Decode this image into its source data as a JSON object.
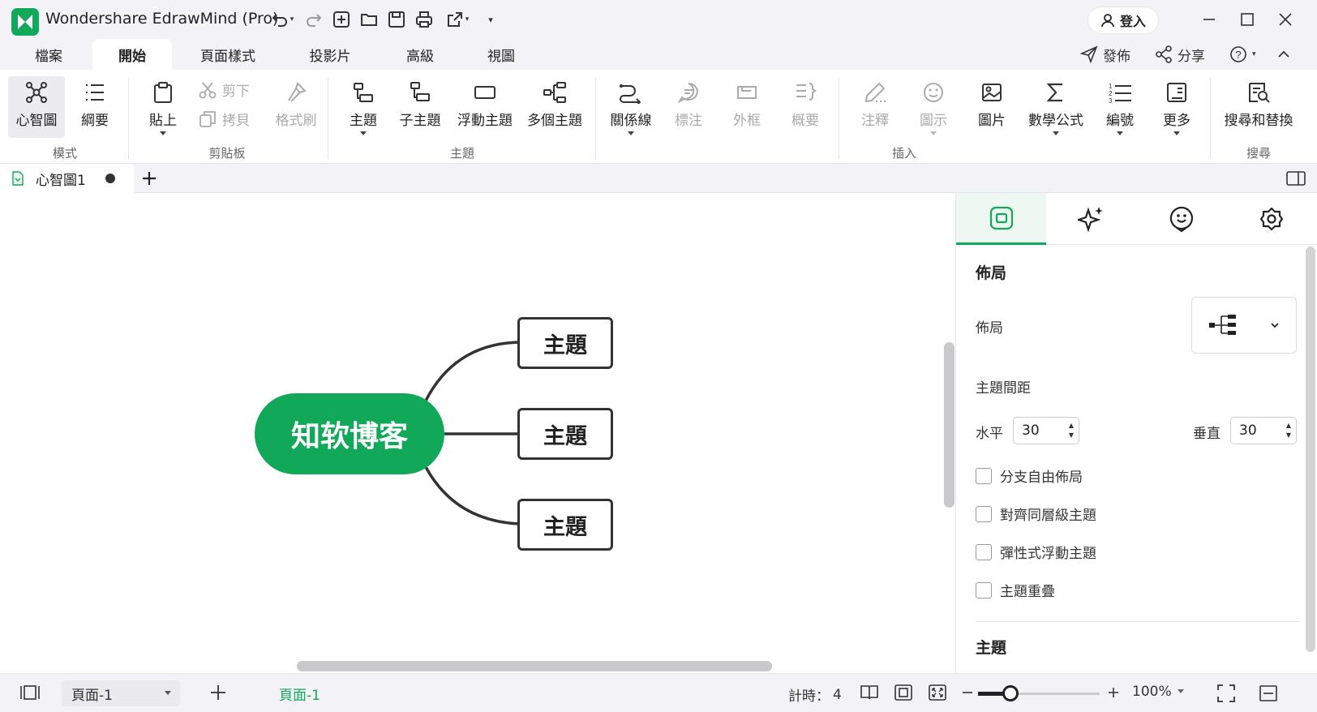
{
  "app": {
    "title": "Wondershare EdrawMind (Pro)",
    "login_label": "登入"
  },
  "menu": {
    "tabs": [
      "檔案",
      "開始",
      "頁面樣式",
      "投影片",
      "高級",
      "視圖"
    ],
    "active": "開始",
    "publish": "發佈",
    "share": "分享"
  },
  "ribbon": {
    "mode": {
      "mindmap": "心智圖",
      "outline": "綱要",
      "group": "模式"
    },
    "clipboard": {
      "paste": "貼上",
      "cut": "剪下",
      "copy": "拷貝",
      "format_painter": "格式刷",
      "group": "剪貼板"
    },
    "topic": {
      "topic": "主題",
      "subtopic": "子主題",
      "floating": "浮動主題",
      "multiple": "多個主題",
      "group": "主題"
    },
    "insert": {
      "relation": "關係線",
      "callout": "標注",
      "boundary": "外框",
      "summary": "概要",
      "comment": "注釋",
      "icon": "圖示",
      "picture": "圖片",
      "formula": "數學公式",
      "numbering": "編號",
      "more": "更多",
      "group": "插入"
    },
    "search": {
      "find_replace": "搜尋和替換",
      "group": "搜尋"
    }
  },
  "doc_tab": {
    "name": "心智圖1"
  },
  "mindmap": {
    "central": "知软博客",
    "topics": [
      "主題",
      "主題",
      "主題"
    ]
  },
  "panel": {
    "section_layout": "佈局",
    "layout_label": "佈局",
    "spacing_label": "主題間距",
    "horizontal_label": "水平",
    "horizontal_value": "30",
    "vertical_label": "垂直",
    "vertical_value": "30",
    "checkboxes": [
      "分支自由佈局",
      "對齊同層級主題",
      "彈性式浮動主題",
      "主題重疊"
    ],
    "section_topic": "主題"
  },
  "status": {
    "page_select": "頁面-1",
    "page_tab": "頁面-1",
    "timer_label": "計時：",
    "timer_value": "4",
    "zoom": "100%"
  },
  "colors": {
    "brand": "#11a85a",
    "accent_active_tab": "#eef7f2"
  }
}
